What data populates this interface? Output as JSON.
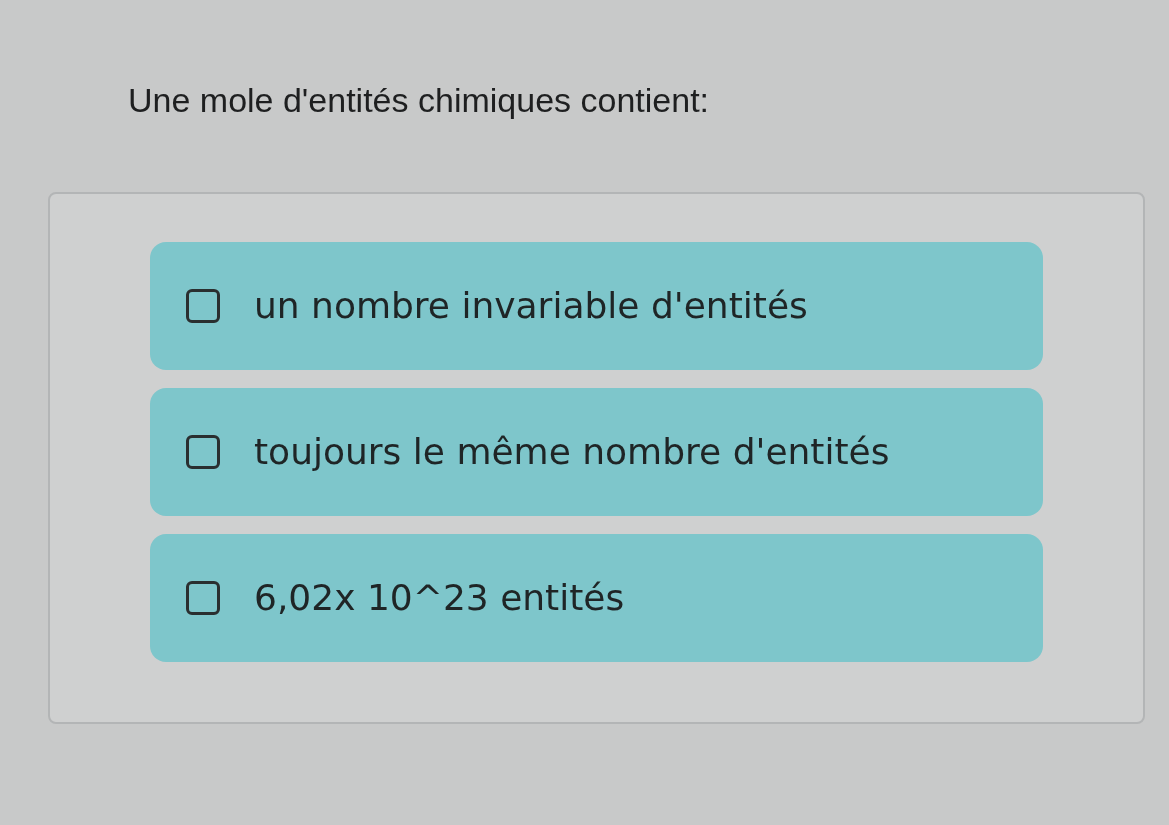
{
  "question": "Une mole d'entités chimiques contient:",
  "options": [
    {
      "label": "un nombre invariable d'entités",
      "checked": false
    },
    {
      "label": "toujours le même nombre d'entités",
      "checked": false
    },
    {
      "label": "6,02x 10^23 entités",
      "checked": false
    }
  ]
}
